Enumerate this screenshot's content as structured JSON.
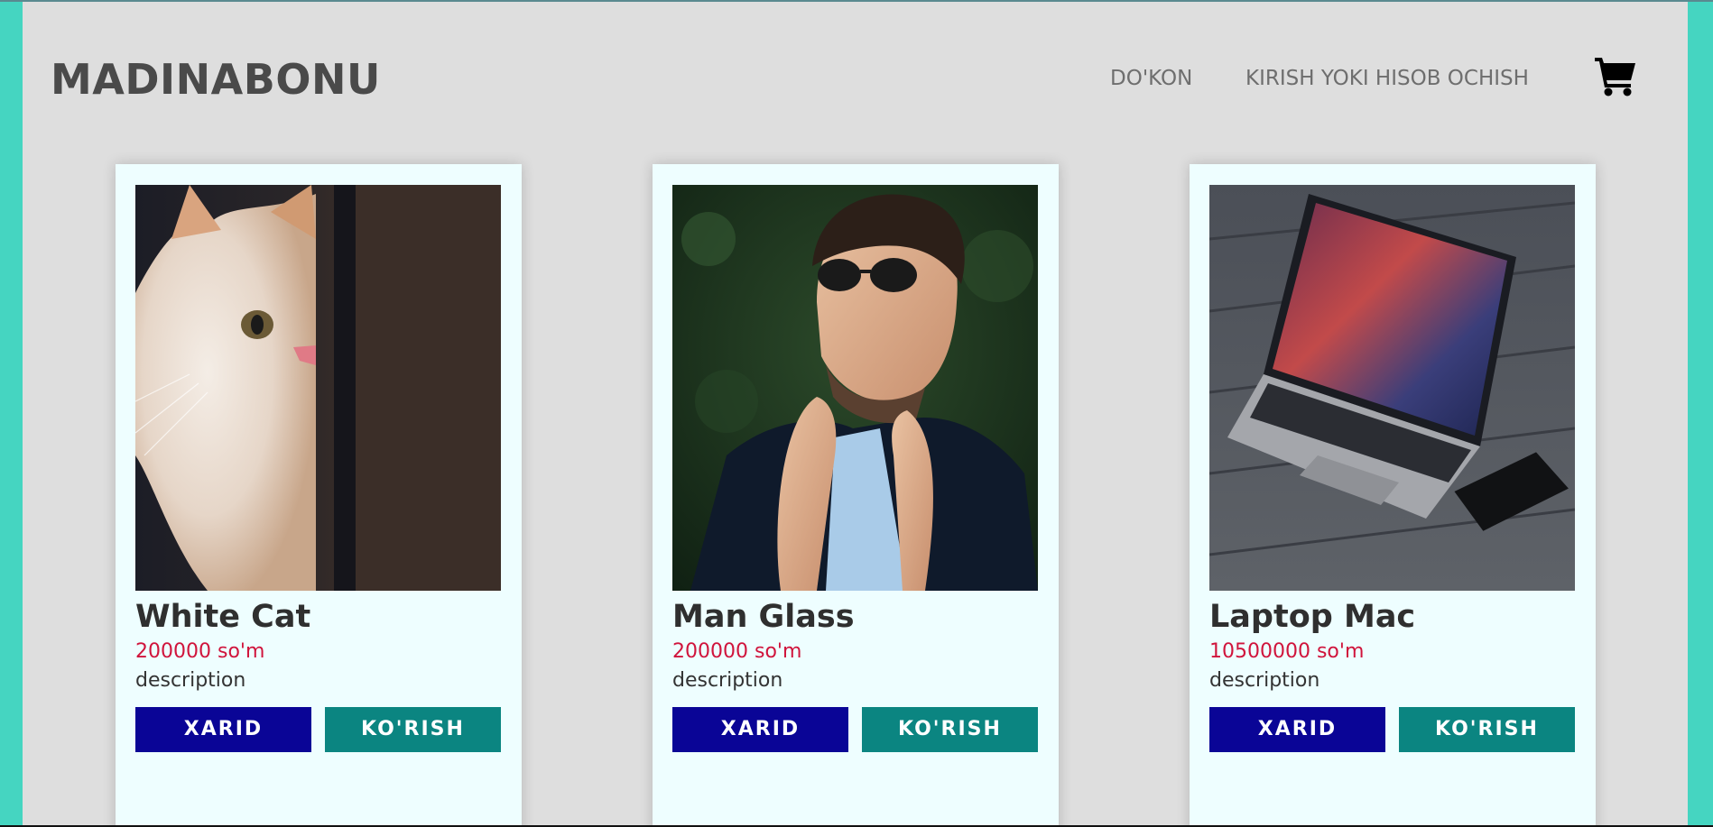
{
  "navbar": {
    "brand": "MADINABONU",
    "links": [
      {
        "label": "DO'KON"
      },
      {
        "label": "KIRISH YOKI HISOB OCHISH"
      }
    ],
    "cart_icon": "shopping-cart-icon"
  },
  "products": [
    {
      "title": "White Cat",
      "price": "200000 so'm",
      "description": "description",
      "buy_label": "XARID",
      "view_label": "KO'RISH"
    },
    {
      "title": "Man Glass",
      "price": "200000 so'm",
      "description": "description",
      "buy_label": "XARID",
      "view_label": "KO'RISH"
    },
    {
      "title": "Laptop Mac",
      "price": "10500000 so'm",
      "description": "description",
      "buy_label": "XARID",
      "view_label": "KO'RISH"
    }
  ],
  "colors": {
    "page_border": "#45d5c1",
    "page_background": "#dedede",
    "card_background": "#eefeff",
    "price": "#d0143c",
    "buy_button": "#0a0596",
    "view_button": "#0b8581"
  }
}
